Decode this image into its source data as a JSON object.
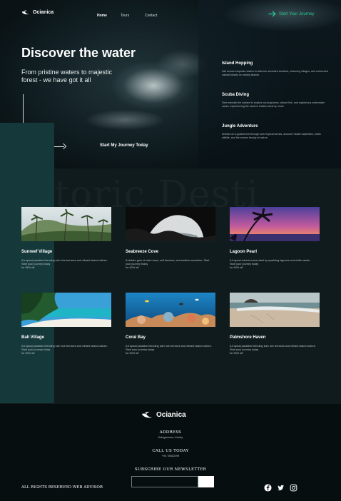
{
  "brand": {
    "name": "Ocianica"
  },
  "nav": {
    "links": [
      "Home",
      "Tours",
      "Contact"
    ],
    "cta": "Start Your Journey"
  },
  "hero": {
    "title": "Discover the water",
    "subtitle": "From pristine waters to majestic forest - we have got it all",
    "cta": "Start My Journey Today"
  },
  "features": [
    {
      "title": "Island Hopping",
      "text": "Sail across turquoise waters to discover secluded beaches, charming villages, and untouched natural beauty on nearby islands."
    },
    {
      "title": "Scuba Diving",
      "text": "Dive beneath the surface to explore coral gardens, vibrant fish, and mysterious underwater caves, experiencing the ocean's hidden world up close."
    },
    {
      "title": "Jungle Adventure",
      "text": "Embark on a guided trek through lush tropical forests, discover hidden waterfalls, exotic wildlife, and the serene beauty of nature."
    }
  ],
  "background_word": "toric Desti",
  "cards": [
    {
      "title": "Sunreef Village",
      "text": "A tropical paradise blending lush rice terraces and vibrant island culture. Start your journey today",
      "discount": "for 58% off."
    },
    {
      "title": "Seabreeze Cove",
      "text": "A hidden gem of calm seas, soft breezes, and endless sunshine. Start your journey today",
      "discount": "for 60% off."
    },
    {
      "title": "Lagoon Pearl",
      "text": "A tropical retreat surrounded by sparkling lagoons and white sands. Start your journey today",
      "discount": "for 60% off."
    },
    {
      "title": "Bali Village",
      "text": "A tropical paradise blending lush rice terraces and vibrant island culture. Start your journey today",
      "discount": "for 50% off."
    },
    {
      "title": "Coral Bay",
      "text": "A tropical paradise blending lush rice terraces and vibrant island culture. Start your journey today",
      "discount": "for 50% off."
    },
    {
      "title": "Palmshore Haven",
      "text": "A tropical paradise blending lush rice terraces and vibrant island culture. Start your journey today",
      "discount": "for 50% off."
    }
  ],
  "footer": {
    "address_heading": "ADDRESS",
    "address": "Kalugannoru, Kandy",
    "call_heading": "CALL US TODAY",
    "phone": "+94 78362299",
    "newsletter_heading": "SUBSCRIBE OUR NEWSLETTER",
    "newsletter_placeholder": "",
    "rights": "ALL RIGHTS RESERVED WEB ADVISOR"
  },
  "colors": {
    "accent": "#27c78b",
    "teal_panel": "#15383a",
    "background": "#0f1b1d",
    "footer": "#070e0f"
  },
  "icons": [
    "arrow-right-icon",
    "facebook-icon",
    "twitter-icon",
    "instagram-icon"
  ]
}
